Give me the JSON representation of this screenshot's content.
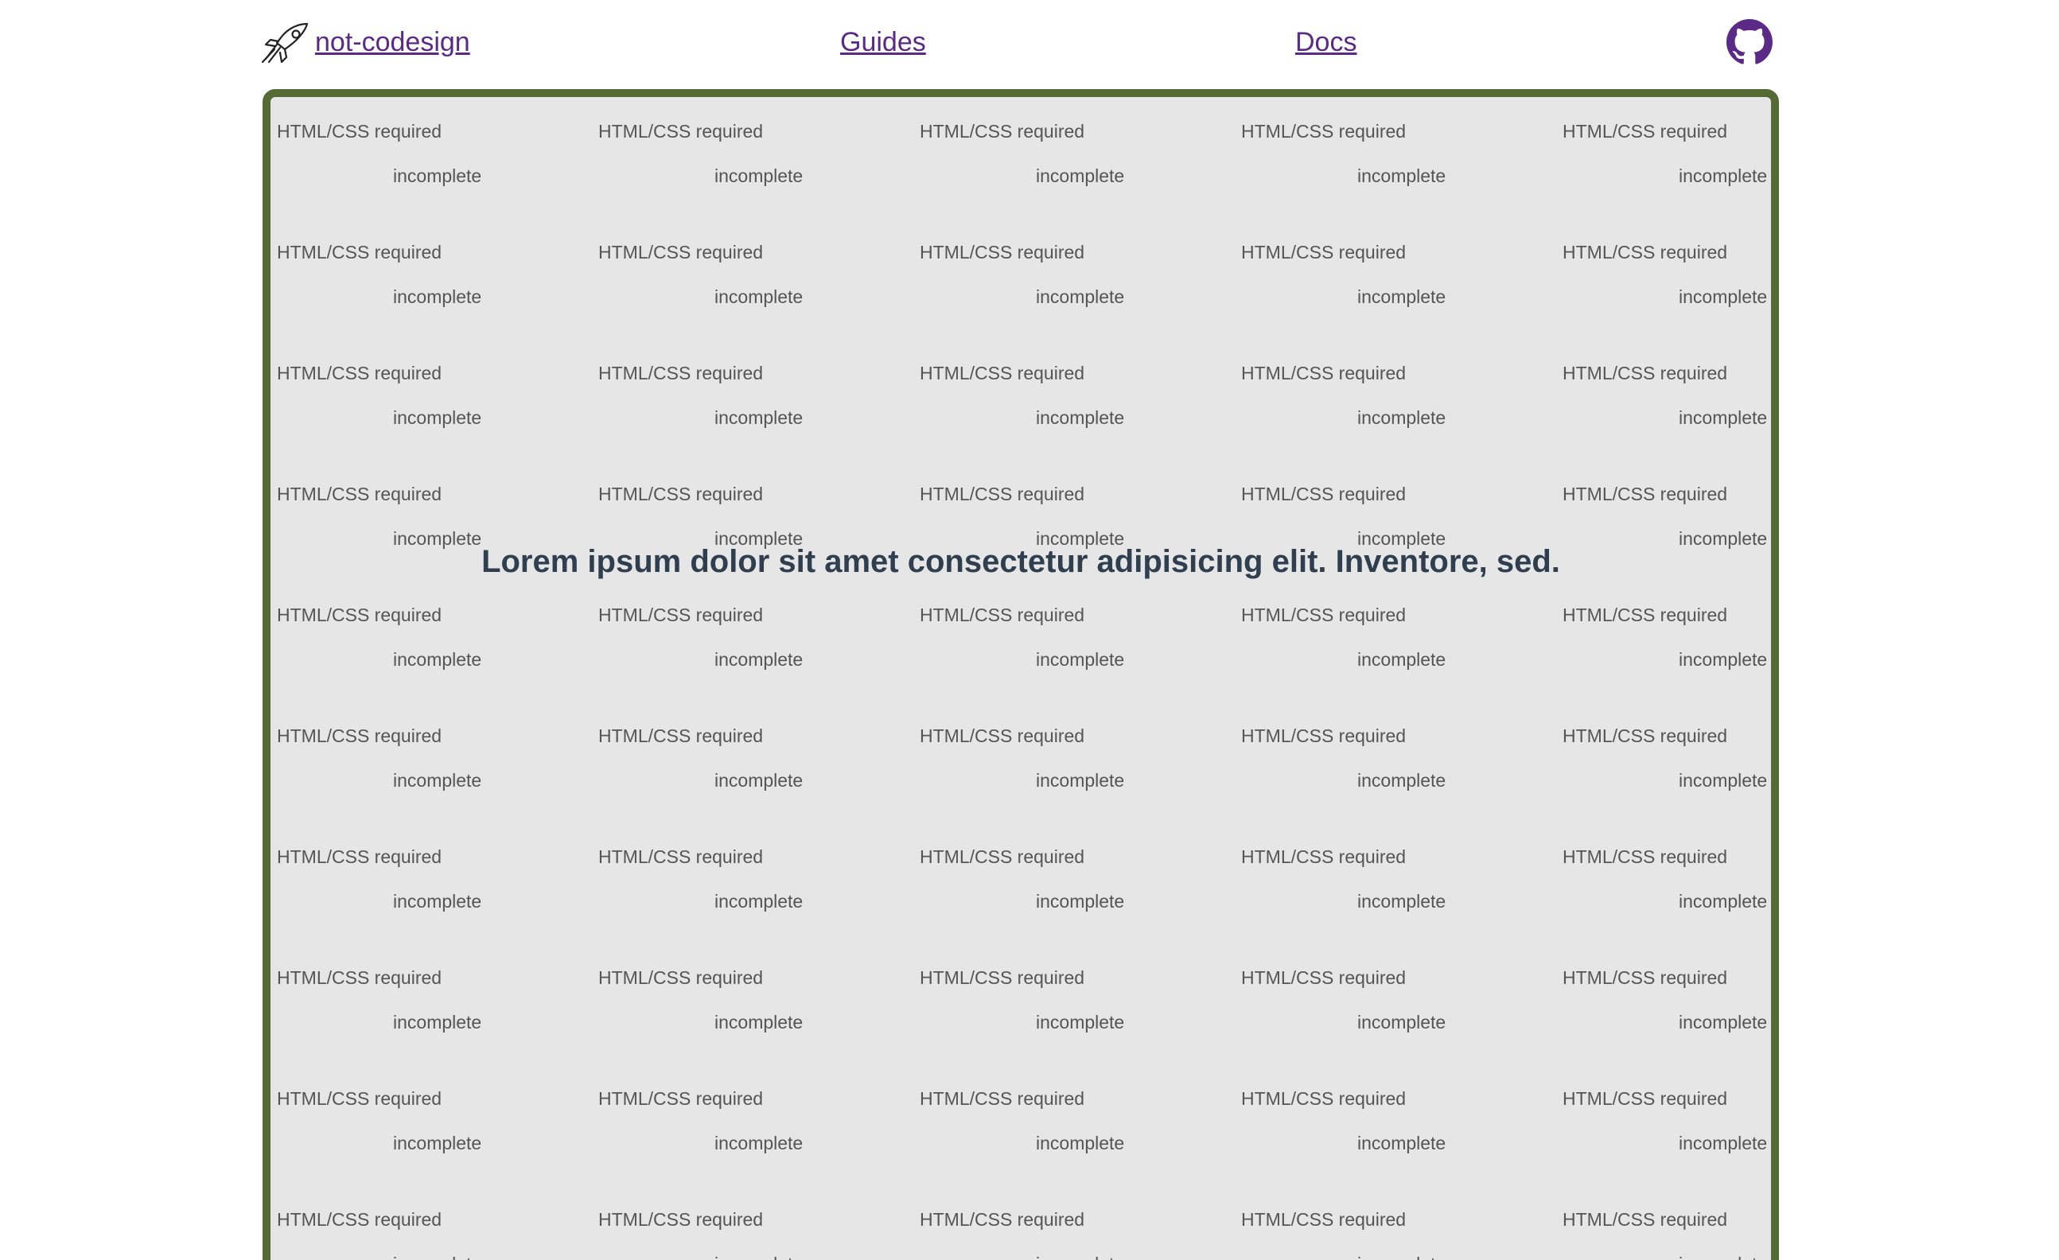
{
  "header": {
    "brand_label": " not-codesign",
    "nav": {
      "guides_label": "Guides",
      "docs_label": "Docs"
    },
    "icons": {
      "brand": "rocket-icon",
      "github": "github-icon"
    }
  },
  "main": {
    "headline": "Lorem ipsum dolor sit amet consectetur adipisicing elit. Inventore, sed.",
    "grid": [
      [
        {
          "label": "HTML/CSS required",
          "status": "incomplete"
        },
        {
          "label": "HTML/CSS required",
          "status": "incomplete"
        },
        {
          "label": "HTML/CSS required",
          "status": "incomplete"
        },
        {
          "label": "HTML/CSS required",
          "status": "incomplete"
        },
        {
          "label": "HTML/CSS required",
          "status": "incomplete"
        }
      ],
      [
        {
          "label": "HTML/CSS required",
          "status": "incomplete"
        },
        {
          "label": "HTML/CSS required",
          "status": "incomplete"
        },
        {
          "label": "HTML/CSS required",
          "status": "incomplete"
        },
        {
          "label": "HTML/CSS required",
          "status": "incomplete"
        },
        {
          "label": "HTML/CSS required",
          "status": "incomplete"
        }
      ],
      [
        {
          "label": "HTML/CSS required",
          "status": "incomplete"
        },
        {
          "label": "HTML/CSS required",
          "status": "incomplete"
        },
        {
          "label": "HTML/CSS required",
          "status": "incomplete"
        },
        {
          "label": "HTML/CSS required",
          "status": "incomplete"
        },
        {
          "label": "HTML/CSS required",
          "status": "incomplete"
        }
      ],
      [
        {
          "label": "HTML/CSS required",
          "status": "incomplete"
        },
        {
          "label": "HTML/CSS required",
          "status": "incomplete"
        },
        {
          "label": "HTML/CSS required",
          "status": "incomplete"
        },
        {
          "label": "HTML/CSS required",
          "status": "incomplete"
        },
        {
          "label": "HTML/CSS required",
          "status": "incomplete"
        }
      ],
      [
        {
          "label": "HTML/CSS required",
          "status": "incomplete"
        },
        {
          "label": "HTML/CSS required",
          "status": "incomplete"
        },
        {
          "label": "HTML/CSS required",
          "status": "incomplete"
        },
        {
          "label": "HTML/CSS required",
          "status": "incomplete"
        },
        {
          "label": "HTML/CSS required",
          "status": "incomplete"
        }
      ],
      [
        {
          "label": "HTML/CSS required",
          "status": "incomplete"
        },
        {
          "label": "HTML/CSS required",
          "status": "incomplete"
        },
        {
          "label": "HTML/CSS required",
          "status": "incomplete"
        },
        {
          "label": "HTML/CSS required",
          "status": "incomplete"
        },
        {
          "label": "HTML/CSS required",
          "status": "incomplete"
        }
      ],
      [
        {
          "label": "HTML/CSS required",
          "status": "incomplete"
        },
        {
          "label": "HTML/CSS required",
          "status": "incomplete"
        },
        {
          "label": "HTML/CSS required",
          "status": "incomplete"
        },
        {
          "label": "HTML/CSS required",
          "status": "incomplete"
        },
        {
          "label": "HTML/CSS required",
          "status": "incomplete"
        }
      ],
      [
        {
          "label": "HTML/CSS required",
          "status": "incomplete"
        },
        {
          "label": "HTML/CSS required",
          "status": "incomplete"
        },
        {
          "label": "HTML/CSS required",
          "status": "incomplete"
        },
        {
          "label": "HTML/CSS required",
          "status": "incomplete"
        },
        {
          "label": "HTML/CSS required",
          "status": "incomplete"
        }
      ],
      [
        {
          "label": "HTML/CSS required",
          "status": "incomplete"
        },
        {
          "label": "HTML/CSS required",
          "status": "incomplete"
        },
        {
          "label": "HTML/CSS required",
          "status": "incomplete"
        },
        {
          "label": "HTML/CSS required",
          "status": "incomplete"
        },
        {
          "label": "HTML/CSS required",
          "status": "incomplete"
        }
      ],
      [
        {
          "label": "HTML/CSS required",
          "status": "incomplete"
        },
        {
          "label": "HTML/CSS required",
          "status": "incomplete"
        },
        {
          "label": "HTML/CSS required",
          "status": "incomplete"
        },
        {
          "label": "HTML/CSS required",
          "status": "incomplete"
        },
        {
          "label": "HTML/CSS required",
          "status": "incomplete"
        }
      ]
    ]
  },
  "colors": {
    "link": "#5b2a86",
    "panel_border": "#556b35",
    "panel_bg": "#e6e6e6",
    "headline": "#2f3f4f",
    "cell_text": "#555555"
  }
}
